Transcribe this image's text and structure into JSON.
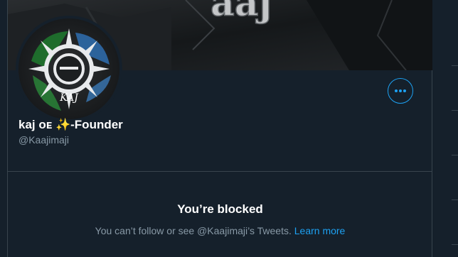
{
  "profile": {
    "banner_text": "aaj",
    "avatar_label": "KAJ",
    "display_name": "kaj ᴏᴇ ✨-Founder",
    "handle": "@Kaajimaji"
  },
  "actions": {
    "more_icon": "more-horizontal-icon"
  },
  "blocked": {
    "title": "You’re blocked",
    "message_prefix": "You can’t follow or see @Kaajimaji’s Tweets.",
    "learn_more": "Learn more"
  },
  "colors": {
    "background": "#15202b",
    "accent": "#1da1f2",
    "secondary_text": "#8899a6",
    "border": "#38444d"
  }
}
